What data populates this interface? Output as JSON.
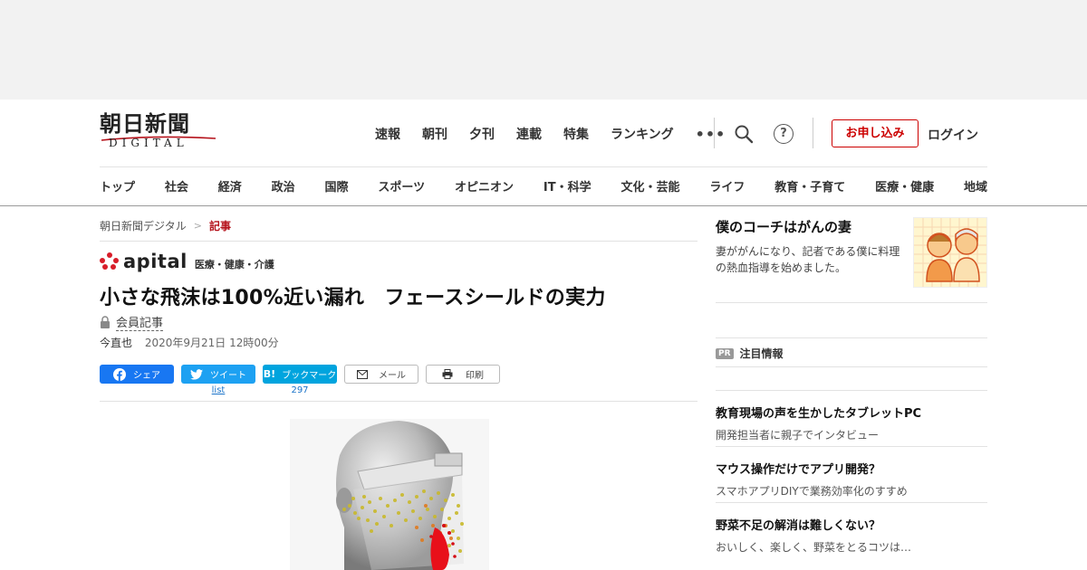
{
  "logo": {
    "main": "朝日新聞",
    "sub": "DIGITAL"
  },
  "top_nav": [
    "速報",
    "朝刊",
    "夕刊",
    "連載",
    "特集",
    "ランキング"
  ],
  "header_actions": {
    "apply": "お申し込み",
    "login": "ログイン",
    "help": "?"
  },
  "categories": [
    "トップ",
    "社会",
    "経済",
    "政治",
    "国際",
    "スポーツ",
    "オピニオン",
    "IT・科学",
    "文化・芸能",
    "ライフ",
    "教育・子育て",
    "医療・健康",
    "地域"
  ],
  "breadcrumb": {
    "home": "朝日新聞デジタル",
    "sep": ">",
    "current": "記事"
  },
  "section": {
    "brand": "apital",
    "category": "医療・健康・介護"
  },
  "article": {
    "headline": "小さな飛沫は100%近い漏れ　フェースシールドの実力",
    "member_label": "会員記事",
    "author": "今直也",
    "date": "2020年9月21日 12時00分"
  },
  "share": {
    "facebook": "シェア",
    "twitter": "ツイート",
    "twitter_count": "list",
    "hatena": "ブックマーク",
    "hatena_count": "297",
    "mail": "メール",
    "print": "印刷"
  },
  "sidebar": {
    "feature": {
      "title": "僕のコーチはがんの妻",
      "desc": "妻ががんになり、記者である僕に料理の熱血指導を始めました。"
    },
    "pr_badge": "PR",
    "pr_heading": "注目情報",
    "pr_items": [
      {
        "title": "教育現場の声を生かしたタブレットPC",
        "sub": "開発担当者に親子でインタビュー"
      },
      {
        "title": "マウス操作だけでアプリ開発？",
        "sub": "スマホアプリDIYで業務効率化のすすめ"
      },
      {
        "title": "野菜不足の解消は難しくない？",
        "sub": "おいしく、楽しく、野菜をとるコツは…"
      }
    ]
  },
  "colors": {
    "brand_red": "#b5121b",
    "facebook": "#1877f2",
    "twitter": "#1da1f2",
    "hatena": "#00a4de"
  }
}
